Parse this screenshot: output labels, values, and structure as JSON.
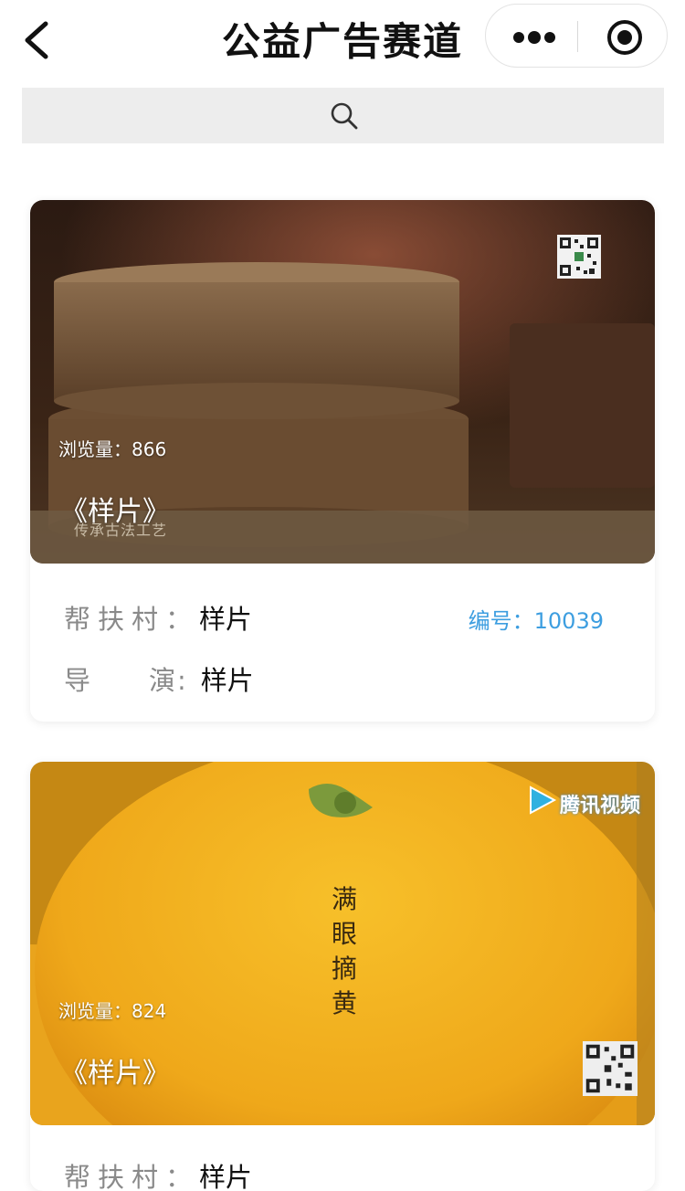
{
  "header": {
    "title": "公益广告赛道"
  },
  "search": {
    "placeholder": ""
  },
  "cards": [
    {
      "views_label": "浏览量：866",
      "title": "《样片》",
      "caption": "传承古法工艺",
      "village_label": "帮扶村：",
      "village_value": "样片",
      "id_label": "编号：10039",
      "director_label": "导　　演:",
      "director_value": "样片"
    },
    {
      "views_label": "浏览量：824",
      "title": "《样片》",
      "caption": "满眼摘黄",
      "watermark": "腾讯视频",
      "village_label": "帮扶村：",
      "village_value": "样片"
    }
  ],
  "colors": {
    "accent": "#3d9ee0",
    "search_bg": "#ededed"
  },
  "icons": [
    "back-icon",
    "more-icon",
    "target-icon",
    "search-icon",
    "qr-code-icon",
    "play-icon"
  ]
}
